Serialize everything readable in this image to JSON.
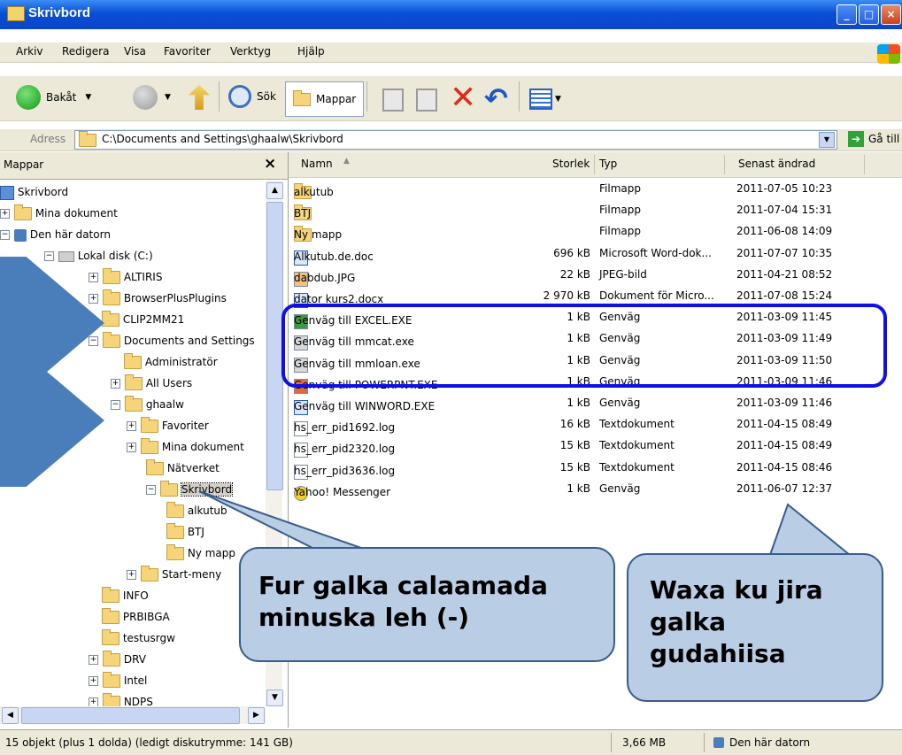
{
  "window": {
    "title": "Skrivbord"
  },
  "menu": [
    "Arkiv",
    "Redigera",
    "Visa",
    "Favoriter",
    "Verktyg",
    "Hjälp"
  ],
  "toolbar": {
    "back": "Bakåt",
    "search": "Sök",
    "folders": "Mappar"
  },
  "address": {
    "label": "Adress",
    "value": "C:\\Documents and Settings\\ghaalw\\Skrivbord",
    "go": "Gå till"
  },
  "left": {
    "header": "Mappar",
    "close": "×"
  },
  "tree": [
    {
      "label": "Skrivbord",
      "indent": 0,
      "pm": "",
      "icon": "desktop"
    },
    {
      "label": "Mina dokument",
      "indent": 1,
      "pm": "+",
      "icon": "docs"
    },
    {
      "label": "Den här datorn",
      "indent": 1,
      "pm": "−",
      "icon": "computer"
    },
    {
      "label": "Lokal disk (C:)",
      "indent": 2,
      "pm": "−",
      "icon": "disk"
    },
    {
      "label": "ALTIRIS",
      "indent": 3,
      "pm": "+",
      "icon": "folder"
    },
    {
      "label": "BrowserPlusPlugins",
      "indent": 3,
      "pm": "+",
      "icon": "folder"
    },
    {
      "label": "CLIP2MM21",
      "indent": 3,
      "pm": "",
      "icon": "folder"
    },
    {
      "label": "Documents and Settings",
      "indent": 3,
      "pm": "−",
      "icon": "folder"
    },
    {
      "label": "Administratör",
      "indent": 4,
      "pm": "",
      "icon": "folder"
    },
    {
      "label": "All Users",
      "indent": 4,
      "pm": "+",
      "icon": "folder"
    },
    {
      "label": "ghaalw",
      "indent": 4,
      "pm": "−",
      "icon": "folder"
    },
    {
      "label": "Favoriter",
      "indent": 5,
      "pm": "+",
      "icon": "folder"
    },
    {
      "label": "Mina dokument",
      "indent": 5,
      "pm": "+",
      "icon": "folder"
    },
    {
      "label": "Nätverket",
      "indent": 5,
      "pm": "",
      "icon": "folder"
    },
    {
      "label": "Skrivbord",
      "indent": 5,
      "pm": "−",
      "icon": "folder",
      "selected": true
    },
    {
      "label": "alkutub",
      "indent": 6,
      "pm": "",
      "icon": "folder"
    },
    {
      "label": "BTJ",
      "indent": 6,
      "pm": "",
      "icon": "folder"
    },
    {
      "label": "Ny mapp",
      "indent": 6,
      "pm": "",
      "icon": "folder"
    },
    {
      "label": "Start-meny",
      "indent": 5,
      "pm": "+",
      "icon": "folder"
    },
    {
      "label": "INFO",
      "indent": 3,
      "pm": "",
      "icon": "folder"
    },
    {
      "label": "PRBIBGA",
      "indent": 3,
      "pm": "",
      "icon": "folder"
    },
    {
      "label": "testusrgw",
      "indent": 3,
      "pm": "",
      "icon": "folder"
    },
    {
      "label": "DRV",
      "indent": 2,
      "pm": "+",
      "icon": "folder"
    },
    {
      "label": "Intel",
      "indent": 2,
      "pm": "+",
      "icon": "folder"
    },
    {
      "label": "NDPS",
      "indent": 2,
      "pm": "+",
      "icon": "folder"
    }
  ],
  "columns": {
    "name": "Namn",
    "size": "Storlek",
    "type": "Typ",
    "date": "Senast ändrad"
  },
  "files": [
    {
      "name": "alkutub",
      "size": "",
      "type": "Filmapp",
      "date": "2011-07-05 10:23",
      "icon": "folder"
    },
    {
      "name": "BTJ",
      "size": "",
      "type": "Filmapp",
      "date": "2011-07-04 15:31",
      "icon": "folder"
    },
    {
      "name": "Ny mapp",
      "size": "",
      "type": "Filmapp",
      "date": "2011-06-08 14:09",
      "icon": "folder"
    },
    {
      "name": "Alkutub.de.doc",
      "size": "696 kB",
      "type": "Microsoft Word-dok...",
      "date": "2011-07-07 10:35",
      "icon": "word"
    },
    {
      "name": "dabdub.JPG",
      "size": "22 kB",
      "type": "JPEG-bild",
      "date": "2011-04-21 08:52",
      "icon": "image"
    },
    {
      "name": "dator kurs2.docx",
      "size": "2 970 kB",
      "type": "Dokument för Micro...",
      "date": "2011-07-08 15:24",
      "icon": "word"
    },
    {
      "name": "Genväg till EXCEL.EXE",
      "size": "1 kB",
      "type": "Genväg",
      "date": "2011-03-09 11:45",
      "icon": "excel"
    },
    {
      "name": "Genväg till mmcat.exe",
      "size": "1 kB",
      "type": "Genväg",
      "date": "2011-03-09 11:49",
      "icon": "app"
    },
    {
      "name": "Genväg till mmloan.exe",
      "size": "1 kB",
      "type": "Genväg",
      "date": "2011-03-09 11:50",
      "icon": "app"
    },
    {
      "name": "Genväg till POWERPNT.EXE",
      "size": "1 kB",
      "type": "Genväg",
      "date": "2011-03-09 11:46",
      "icon": "ppt"
    },
    {
      "name": "Genväg till WINWORD.EXE",
      "size": "1 kB",
      "type": "Genväg",
      "date": "2011-03-09 11:46",
      "icon": "word"
    },
    {
      "name": "hs_err_pid1692.log",
      "size": "16 kB",
      "type": "Textdokument",
      "date": "2011-04-15 08:49",
      "icon": "text"
    },
    {
      "name": "hs_err_pid2320.log",
      "size": "15 kB",
      "type": "Textdokument",
      "date": "2011-04-15 08:49",
      "icon": "text"
    },
    {
      "name": "hs_err_pid3636.log",
      "size": "15 kB",
      "type": "Textdokument",
      "date": "2011-04-15 08:46",
      "icon": "text"
    },
    {
      "name": "Yahoo! Messenger",
      "size": "1 kB",
      "type": "Genväg",
      "date": "2011-06-07 12:37",
      "icon": "yahoo"
    }
  ],
  "status": {
    "objects": "15 objekt (plus 1 dolda) (ledigt diskutrymme: 141 GB)",
    "size": "3,66 MB",
    "location": "Den här datorn"
  },
  "callouts": {
    "left": "Fur galka calaamada minuska leh (-)",
    "right": "Waxa ku jira galka gudahiisa"
  },
  "colors": {
    "titlebar": "#0a4ed6",
    "highlight": "#1010e6",
    "callout": "#b9cde5",
    "arrow": "#4a7ebb"
  }
}
